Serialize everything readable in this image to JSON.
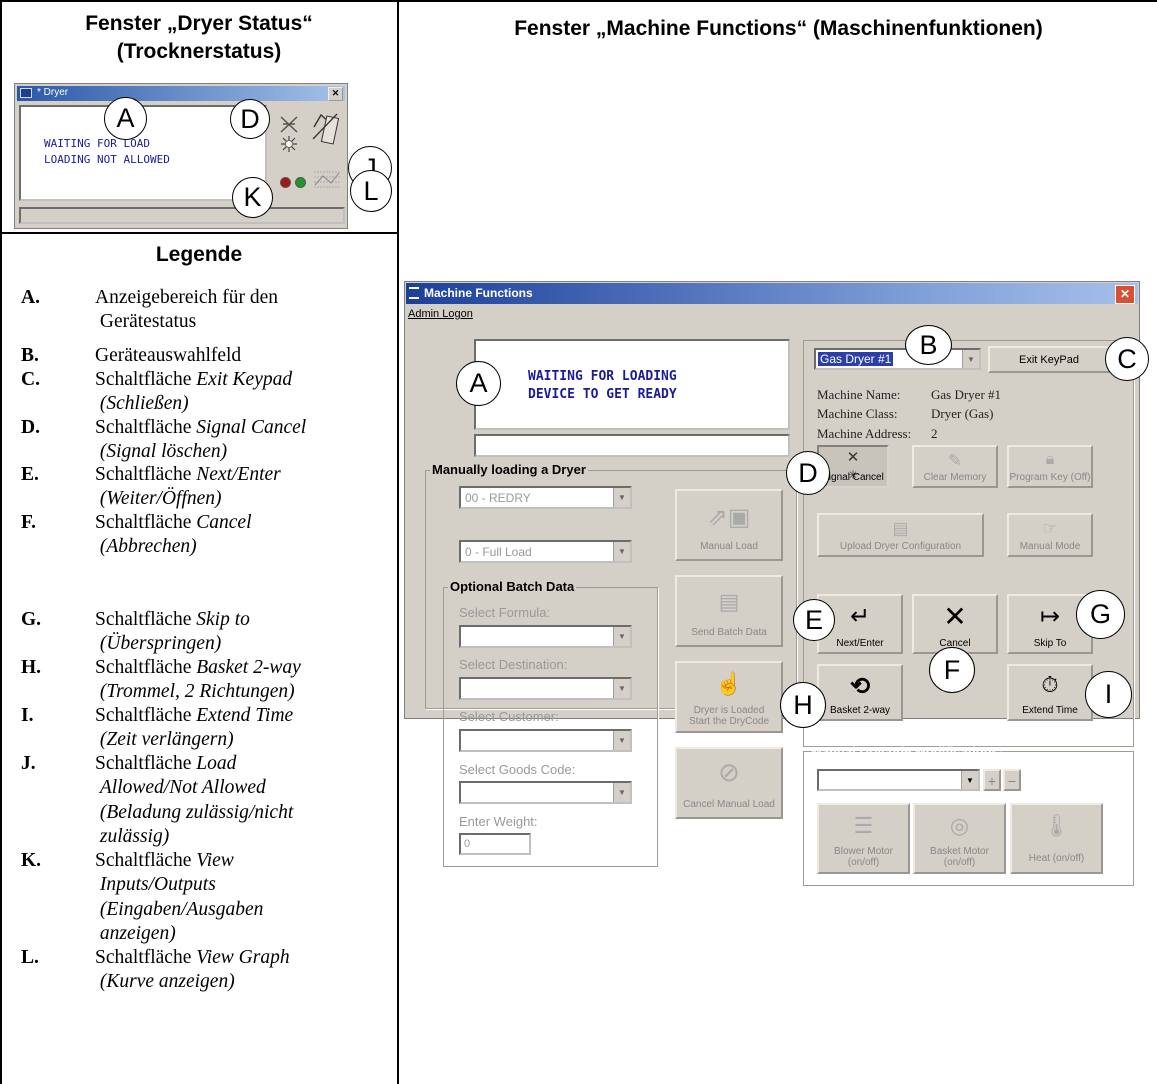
{
  "headers": {
    "left_line1": "Fenster „Dryer Status“",
    "left_line2": "(Trocknerstatus)",
    "right": "Fenster „Machine Functions“ (Maschinenfunktionen)",
    "legend": "Legende"
  },
  "dryer_window": {
    "title": "* Dryer",
    "line1": "WAITING FOR LOAD",
    "line2": "LOADING NOT ALLOWED"
  },
  "callouts": {
    "A": "A",
    "B": "B",
    "C": "C",
    "D": "D",
    "E": "E",
    "F": "F",
    "G": "G",
    "H": "H",
    "I": "I",
    "J": "J",
    "K": "K",
    "L": "L"
  },
  "legend": [
    {
      "key": "A.",
      "plain": "Anzeigebereich für den",
      "plain2": "Gerätestatus"
    },
    {
      "key": "B.",
      "plain": "Geräteauswahlfeld"
    },
    {
      "key": "C.",
      "plain": "Schaltfläche ",
      "ital": "Exit Keypad",
      "ital2": "(Schließen)"
    },
    {
      "key": "D.",
      "plain": "Schaltfläche ",
      "ital": "Signal Cancel",
      "ital2": "(Signal löschen)"
    },
    {
      "key": "E.",
      "plain": "Schaltfläche ",
      "ital": "Next/Enter",
      "ital2": "(Weiter/Öffnen)"
    },
    {
      "key": "F.",
      "plain": "Schaltfläche ",
      "ital": "Cancel",
      "ital2": "(Abbrechen)"
    },
    {
      "key": "G.",
      "plain": "Schaltfläche ",
      "ital": "Skip to",
      "ital2": "(Überspringen)"
    },
    {
      "key": "H.",
      "plain": "Schaltfläche ",
      "ital": "Basket 2-way",
      "ital2": "(Trommel, 2 Richtungen)"
    },
    {
      "key": "I.",
      "plain": "Schaltfläche ",
      "ital": "Extend Time",
      "ital2": "(Zeit verlängern)"
    },
    {
      "key": "J.",
      "plain": "Schaltfläche  ",
      "ital": "Load",
      "ital2": "Allowed/Not Allowed",
      "ital3": "(Beladung zulässig/nicht",
      "ital4": "zulässig)"
    },
    {
      "key": "K.",
      "plain": "Schaltfläche ",
      "ital": "View",
      "ital2": "Inputs/Outputs",
      "ital3": "(Eingaben/Ausgaben",
      "ital4": "anzeigen)"
    },
    {
      "key": "L.",
      "plain": "Schaltfläche ",
      "ital": "View Graph",
      "ital2": "(Kurve anzeigen)"
    }
  ],
  "mf": {
    "title": "Machine Functions",
    "menu": "Admin Logon",
    "status_line1": "WAITING FOR LOADING",
    "status_line2": "DEVICE TO GET READY",
    "device_select": "Gas Dryer #1",
    "exit_keypad": "Exit KeyPad",
    "info": {
      "name_label": "Machine Name:",
      "name_value": "Gas Dryer #1",
      "class_label": "Machine Class:",
      "class_value": "Dryer (Gas)",
      "address_label": "Machine Address:",
      "address_value": "2"
    },
    "buttons": {
      "signal_cancel": "Signal Cancel",
      "clear_memory": "Clear Memory",
      "program_key": "Program Key (Off)",
      "upload_config": "Upload Dryer Configuration",
      "manual_mode": "Manual Mode",
      "next_enter": "Next/Enter",
      "cancel": "Cancel",
      "skip_to": "Skip To",
      "basket_2way": "Basket 2-way",
      "extend_time": "Extend Time",
      "manual_load": "Manual Load",
      "send_batch": "Send Batch Data",
      "dryer_loaded_1": "Dryer is Loaded",
      "dryer_loaded_2": "Start the DryCode",
      "cancel_manual_load": "Cancel Manual Load",
      "blower_1": "Blower Motor",
      "blower_2": "(on/off)",
      "basket_motor_1": "Basket Motor",
      "basket_motor_2": "(on/off)",
      "heat": "Heat (on/off)",
      "plus": "+",
      "minus": "−"
    },
    "manual_group": "Manually loading a Dryer",
    "drycode_select": "00 - REDRY",
    "load_select": "0 - Full Load",
    "batch_group": "Optional Batch Data",
    "labels": {
      "formula": "Select Formula:",
      "destination": "Select Destination:",
      "customer": "Select Customer:",
      "goods": "Select Goods Code:",
      "weight": "Enter Weight:"
    },
    "weight_value": "0",
    "drycode_mods": "Manual Drycode Modifications:"
  }
}
